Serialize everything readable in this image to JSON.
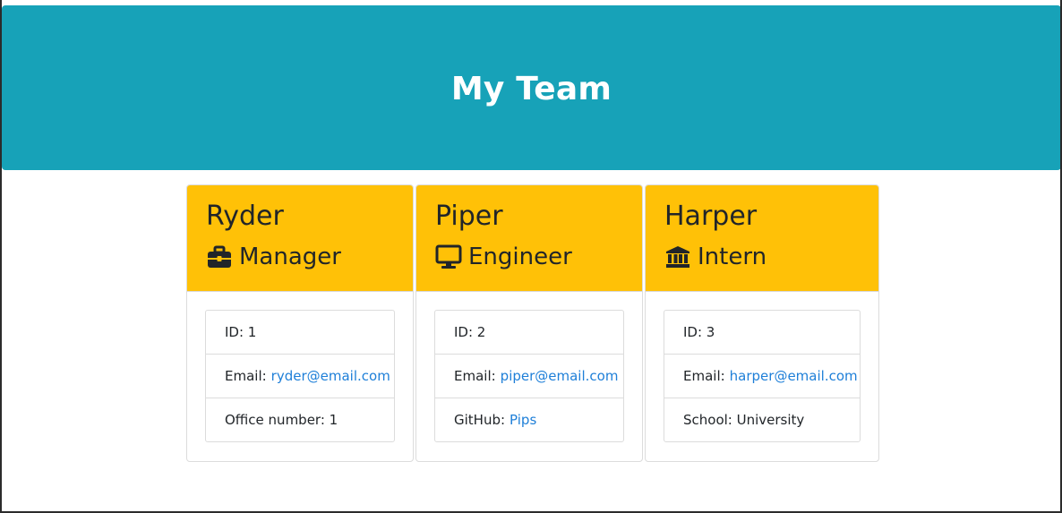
{
  "header": {
    "title": "My Team"
  },
  "team": [
    {
      "name": "Ryder",
      "role": "Manager",
      "role_icon": "briefcase-icon",
      "id_text": "ID: 1",
      "email_label": "Email:",
      "email": "ryder@email.com",
      "extra_label": "Office number: 1",
      "extra_link": ""
    },
    {
      "name": "Piper",
      "role": "Engineer",
      "role_icon": "desktop-icon",
      "id_text": "ID: 2",
      "email_label": "Email:",
      "email": "piper@email.com",
      "extra_label": "GitHub:",
      "extra_link": "Pips"
    },
    {
      "name": "Harper",
      "role": "Intern",
      "role_icon": "university-icon",
      "id_text": "ID: 3",
      "email_label": "Email:",
      "email": "harper@email.com",
      "extra_label": "School: University",
      "extra_link": ""
    }
  ],
  "colors": {
    "header_bg": "#17a2b8",
    "card_header_bg": "#ffc107",
    "link": "#1e7fd8"
  }
}
